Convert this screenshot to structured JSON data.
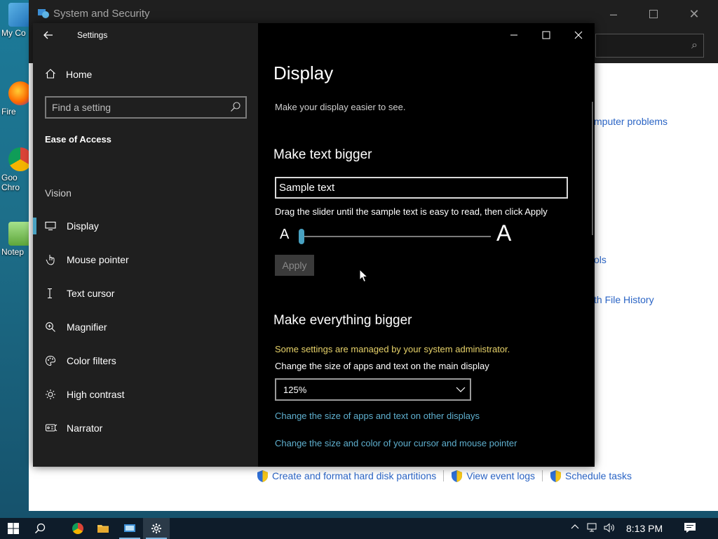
{
  "desktop": {
    "icons": [
      {
        "label": "My Co"
      },
      {
        "label": "Fire"
      },
      {
        "label": "Goo Chro"
      },
      {
        "label": "Notep"
      }
    ]
  },
  "control_panel": {
    "title": "System and Security",
    "links": {
      "troubleshoot_fragment": "mputer problems",
      "tools_fragment": "ols",
      "history_fragment": "th File History"
    },
    "bottom_links": [
      "Create and format hard disk partitions",
      "View event logs",
      "Schedule tasks"
    ]
  },
  "settings": {
    "window_title": "Settings",
    "nav": {
      "home_label": "Home",
      "search_placeholder": "Find a setting",
      "section_label": "Ease of Access",
      "group_label": "Vision",
      "items": [
        {
          "label": "Display"
        },
        {
          "label": "Mouse pointer"
        },
        {
          "label": "Text cursor"
        },
        {
          "label": "Magnifier"
        },
        {
          "label": "Color filters"
        },
        {
          "label": "High contrast"
        },
        {
          "label": "Narrator"
        }
      ]
    },
    "content": {
      "title": "Display",
      "subtitle": "Make your display easier to see.",
      "text_bigger": {
        "heading": "Make text bigger",
        "sample": "Sample text",
        "hint": "Drag the slider until the sample text is easy to read, then click Apply",
        "small_a": "A",
        "big_a": "A",
        "slider_percent": 0,
        "apply_label": "Apply"
      },
      "everything_bigger": {
        "heading": "Make everything bigger",
        "admin_note": "Some settings are managed by your system administrator.",
        "scale_label": "Change the size of apps and text on the main display",
        "scale_value": "125%",
        "link_other_displays": "Change the size of apps and text on other displays",
        "link_cursor": "Change the size and color of your cursor and mouse pointer"
      }
    }
  },
  "taskbar": {
    "clock": "8:13 PM"
  },
  "colors": {
    "accent": "#48a1c1",
    "admin_note": "#e8d36a",
    "link": "#5fb0cf"
  }
}
